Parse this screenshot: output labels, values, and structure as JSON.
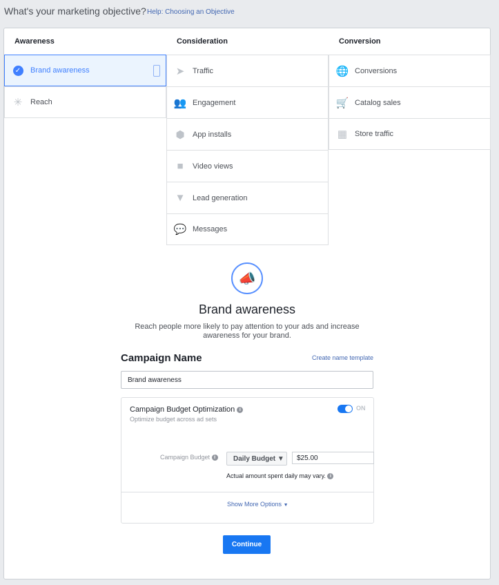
{
  "header": {
    "title": "What's your marketing objective?",
    "help_link": "Help: Choosing an Objective"
  },
  "columns": [
    {
      "heading": "Awareness",
      "items": [
        {
          "label": "Brand awareness",
          "icon": "check-circle-icon",
          "selected": true
        },
        {
          "label": "Reach",
          "icon": "reach-icon"
        }
      ]
    },
    {
      "heading": "Consideration",
      "items": [
        {
          "label": "Traffic",
          "icon": "cursor-icon"
        },
        {
          "label": "Engagement",
          "icon": "people-icon"
        },
        {
          "label": "App installs",
          "icon": "box-icon"
        },
        {
          "label": "Video views",
          "icon": "video-camera-icon"
        },
        {
          "label": "Lead generation",
          "icon": "funnel-icon"
        },
        {
          "label": "Messages",
          "icon": "chat-bubbles-icon"
        }
      ]
    },
    {
      "heading": "Conversion",
      "items": [
        {
          "label": "Conversions",
          "icon": "globe-icon"
        },
        {
          "label": "Catalog sales",
          "icon": "cart-icon"
        },
        {
          "label": "Store traffic",
          "icon": "store-icon"
        }
      ]
    }
  ],
  "objective": {
    "icon": "megaphone-icon",
    "title": "Brand awareness",
    "description": "Reach people more likely to pay attention to your ads and increase awareness for your brand."
  },
  "campaign_name": {
    "label": "Campaign Name",
    "template_link": "Create name template",
    "value": "Brand awareness"
  },
  "cbo": {
    "title": "Campaign Budget Optimization",
    "subtitle": "Optimize budget across ad sets",
    "toggle_label": "ON",
    "toggle_on": true,
    "budget_label": "Campaign Budget",
    "budget_type": "Daily Budget",
    "budget_value": "$25.00",
    "note": "Actual amount spent daily may vary.",
    "more_options": "Show More Options"
  },
  "colors": {
    "accent": "#1877f2",
    "selected": "#4080ff"
  },
  "continue_label": "Continue"
}
